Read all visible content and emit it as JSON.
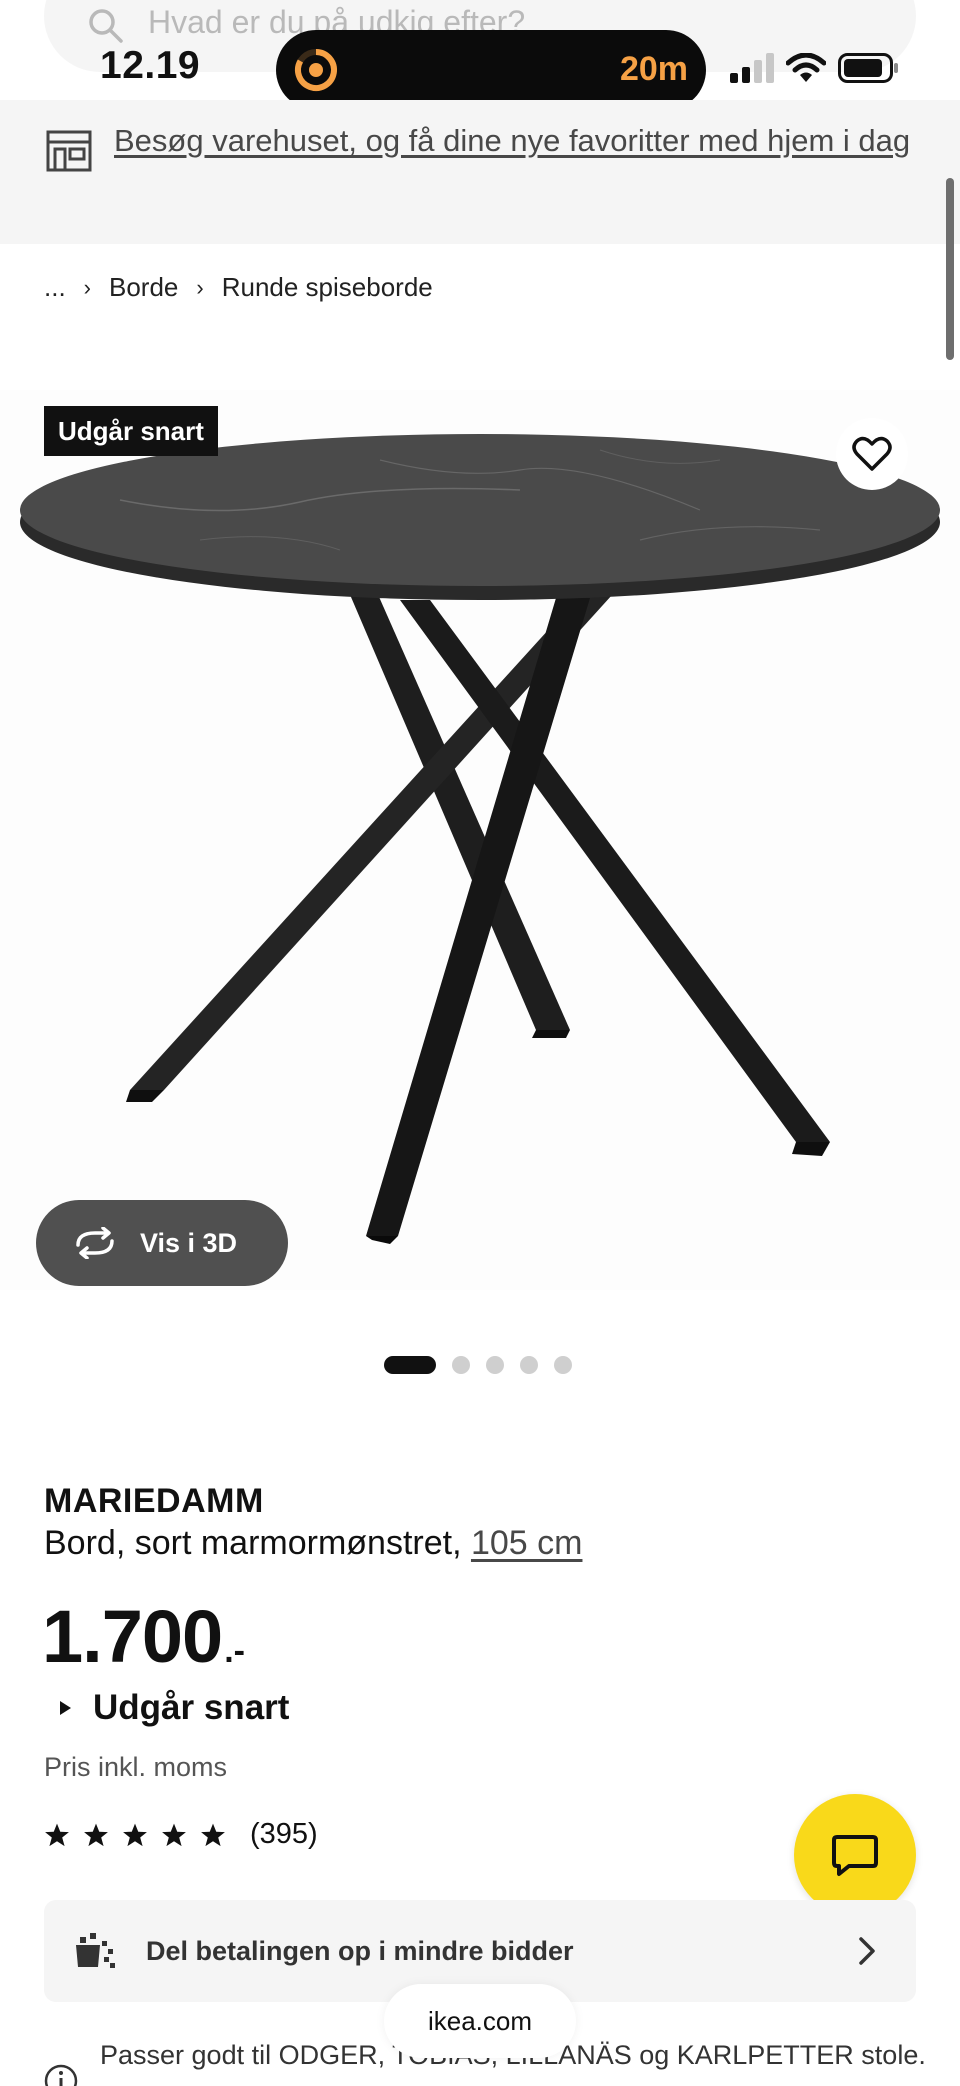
{
  "status_bar": {
    "time": "12.19",
    "timer": "20m"
  },
  "search": {
    "placeholder": "Hvad er du på udkig efter?"
  },
  "store_banner": {
    "link_text": "Besøg varehuset, og få dine nye favoritter med hjem i dag",
    "icon": "store-icon"
  },
  "breadcrumb": {
    "items": [
      "...",
      "Borde",
      "Runde spiseborde"
    ]
  },
  "gallery": {
    "badge": "Udgår snart",
    "view_3d_label": "Vis i 3D",
    "image_count": 5,
    "active_index": 0
  },
  "product": {
    "name": "MARIEDAMM",
    "description": "Bord, sort marmormønstret, ",
    "size": "105 cm",
    "price": "1.700",
    "price_suffix": ".-",
    "availability": "Udgår snart",
    "vat_note": "Pris inkl. moms",
    "rating_stars": 5,
    "rating_count": "(395)"
  },
  "installment": {
    "label": "Del betalingen op i mindre bidder"
  },
  "info": {
    "text": "Passer godt til ODGER, TOBIAS, LILLANÄS og KARLPETTER stole."
  },
  "browser": {
    "url": "ikea.com"
  },
  "colors": {
    "accent_yellow": "#f9d91a",
    "timer_orange": "#f6a145",
    "banner_bg": "#f5f5f5"
  }
}
